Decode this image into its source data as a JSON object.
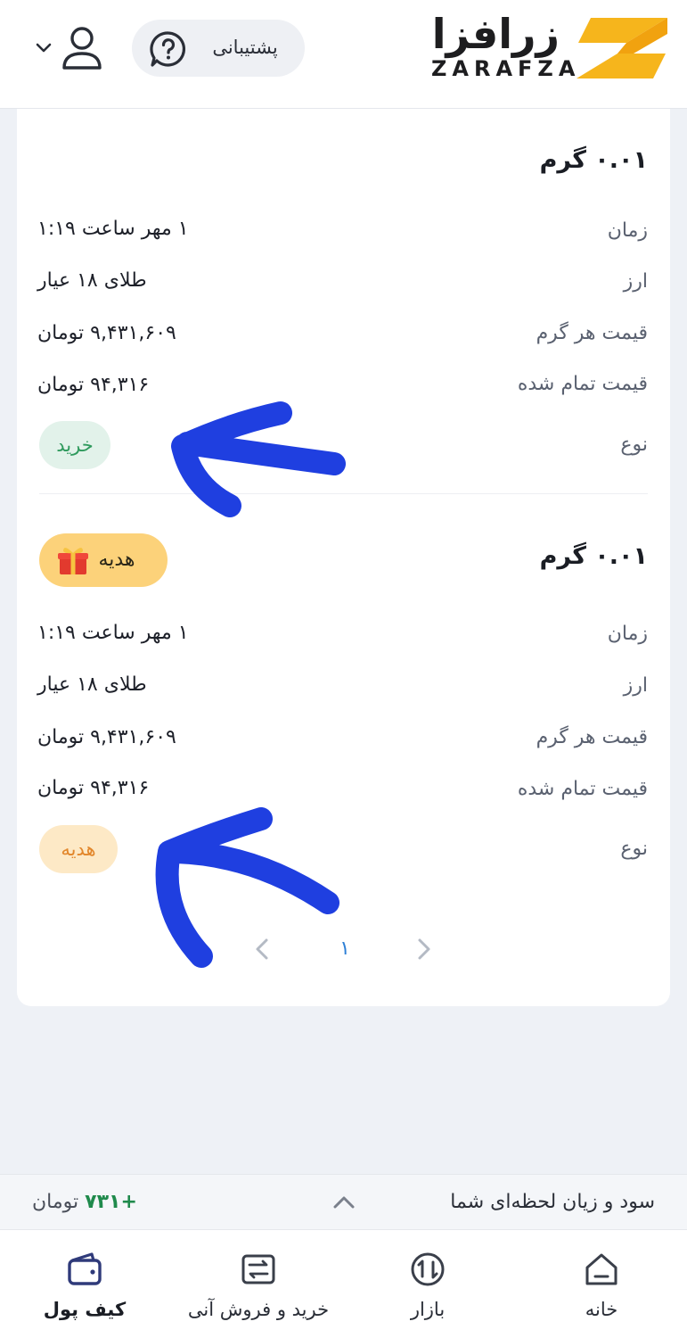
{
  "header": {
    "logo_fa": "زرافزا",
    "logo_en": "ZARAFZA",
    "support_label": "پشتیبانی",
    "brand_color": "#f6b51c"
  },
  "transactions": [
    {
      "title": "۰.۰۱ گرم",
      "gift_label": "",
      "rows": [
        {
          "label": "زمان",
          "value": "۱ مهر ساعت ۱:۱۹"
        },
        {
          "label": "ارز",
          "value": "طلای ۱۸ عیار"
        },
        {
          "label": "قیمت هر گرم",
          "value": "۹,۴۳۱,۶۰۹ تومان"
        },
        {
          "label": "قیمت تمام شده",
          "value": "۹۴,۳۱۶ تومان"
        }
      ],
      "type_label": "نوع",
      "type_value": "خرید"
    },
    {
      "title": "۰.۰۱ گرم",
      "gift_label": "هدیه",
      "rows": [
        {
          "label": "زمان",
          "value": "۱ مهر ساعت ۱:۱۹"
        },
        {
          "label": "ارز",
          "value": "طلای ۱۸ عیار"
        },
        {
          "label": "قیمت هر گرم",
          "value": "۹,۴۳۱,۶۰۹ تومان"
        },
        {
          "label": "قیمت تمام شده",
          "value": "۹۴,۳۱۶ تومان"
        }
      ],
      "type_label": "نوع",
      "type_value": "هدیه"
    }
  ],
  "pagination": {
    "current_page": "۱"
  },
  "profit_bar": {
    "label": "سود و زیان لحظه‌ای شما",
    "value": "+۷۳۱",
    "unit": "تومان"
  },
  "bottom_nav": {
    "home": "خانه",
    "market": "بازار",
    "instant_trade": "خرید و فروش آنی",
    "wallet": "کیف پول"
  }
}
